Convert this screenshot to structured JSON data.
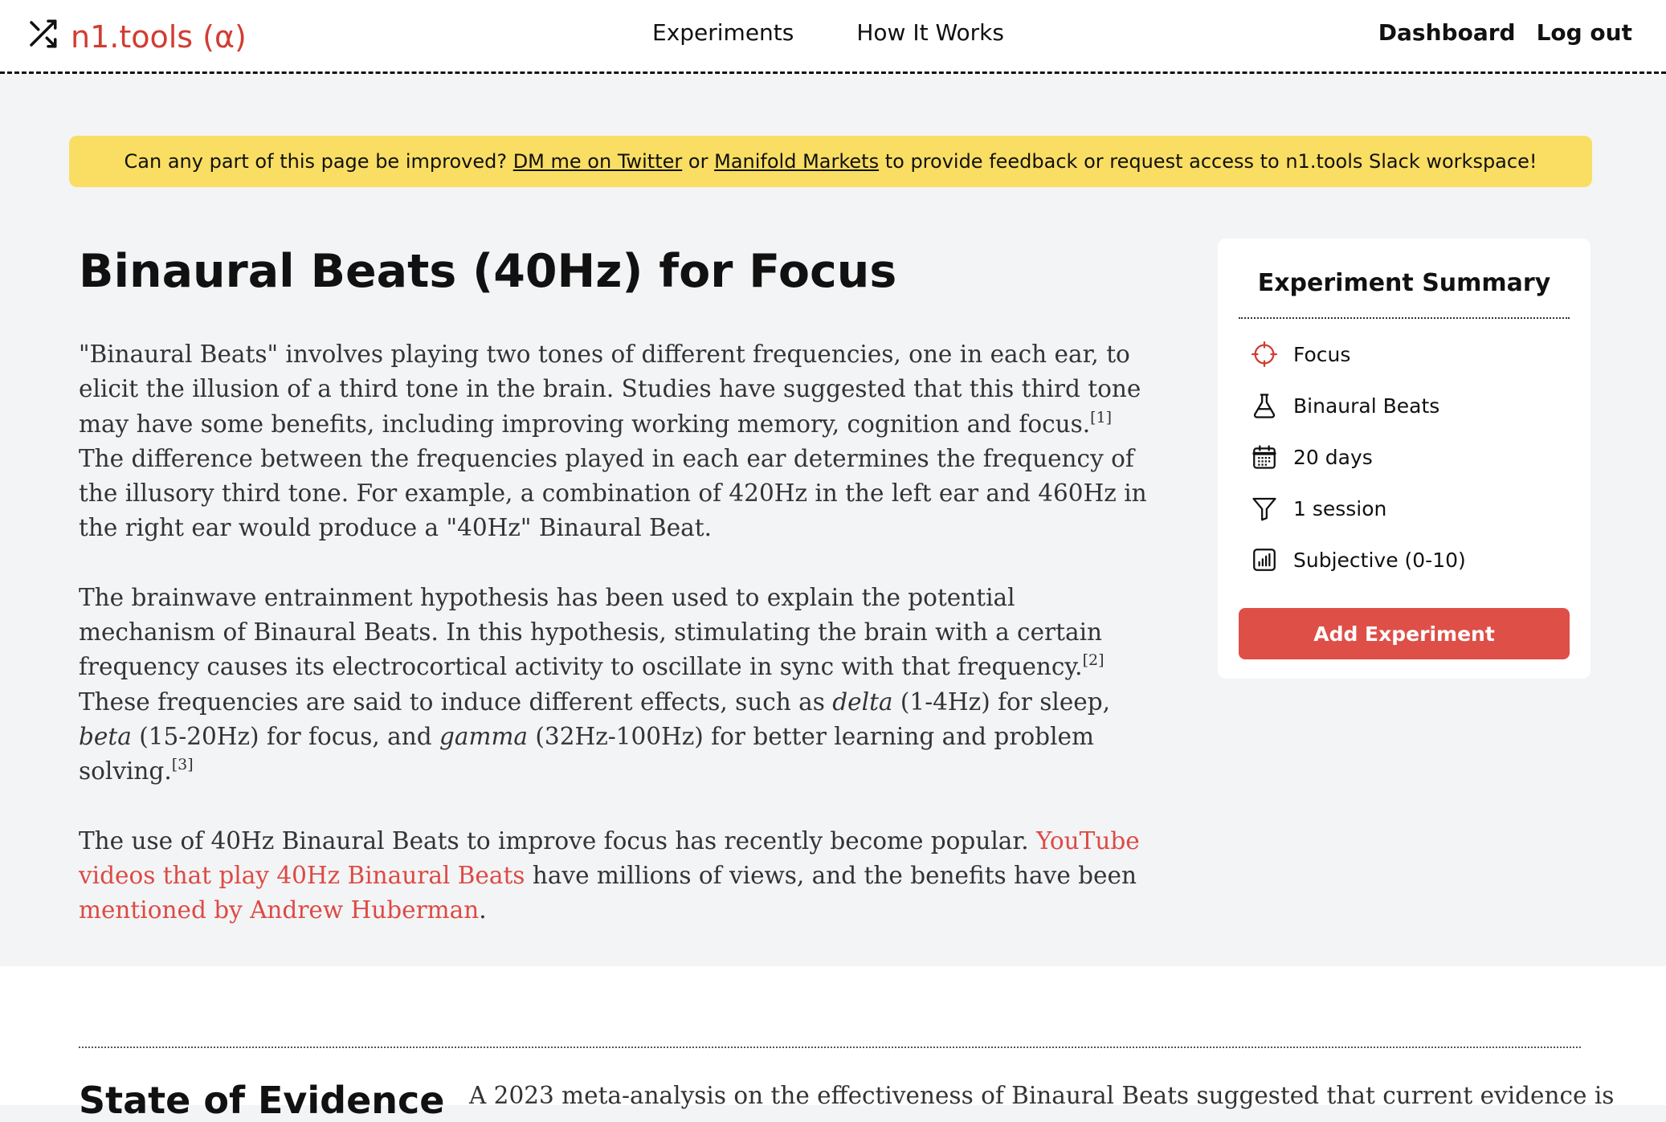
{
  "header": {
    "logo_text": "n1.tools (α)",
    "nav": [
      "Experiments",
      "How It Works"
    ],
    "right": [
      "Dashboard",
      "Log out"
    ]
  },
  "banner": {
    "prefix": "Can any part of this page be improved?",
    "link1": "DM me on Twitter",
    "middle": "or",
    "link2": "Manifold Markets",
    "suffix": "to provide feedback or request access to n1.tools Slack workspace!"
  },
  "article": {
    "title": "Binaural Beats (40Hz) for Focus",
    "p1": {
      "a": "\"Binaural Beats\" involves playing two tones of different frequencies, one in each ear, to elicit the illusion of a third tone in the brain. Studies have suggested that this third tone may have some benefits, including improving working memory, cognition and focus.",
      "ref1": "[1]",
      "b": "The difference between the frequencies played in each ear determines the frequency of the illusory third tone. For example, a combination of 420Hz in the left ear and 460Hz in the right ear would produce a \"40Hz\" Binaural Beat."
    },
    "p2": {
      "a": "The brainwave entrainment hypothesis has been used to explain the potential mechanism of Binaural Beats. In this hypothesis, stimulating the brain with a certain frequency causes its electrocortical activity to oscillate in sync with that frequency.",
      "ref2": "[2]",
      "b": "These frequencies are said to induce different effects, such as",
      "delta": "delta",
      "c": "(1-4Hz) for sleep,",
      "beta": "beta",
      "d": "(15-20Hz) for focus, and",
      "gamma": "gamma",
      "e": "(32Hz-100Hz) for better learning and problem solving.",
      "ref3": "[3]"
    },
    "p3": {
      "a": "The use of 40Hz Binaural Beats to improve focus has recently become popular.",
      "link1": "YouTube videos that play 40Hz Binaural Beats",
      "b": "have millions of views, and the benefits have been",
      "link2": "mentioned by Andrew Huberman",
      "c": "."
    }
  },
  "summary": {
    "title": "Experiment Summary",
    "rows": [
      {
        "icon": "crosshair-icon",
        "label": "Focus"
      },
      {
        "icon": "flask-icon",
        "label": "Binaural Beats"
      },
      {
        "icon": "calendar-icon",
        "label": "20 days"
      },
      {
        "icon": "funnel-icon",
        "label": "1 session"
      },
      {
        "icon": "bar-chart-icon",
        "label": "Subjective (0-10)"
      }
    ],
    "button": "Add Experiment"
  },
  "evidence": {
    "heading": "State of Evidence",
    "text": "A 2023 meta-analysis on the effectiveness of Binaural Beats suggested that current evidence is"
  },
  "colors": {
    "accent": "#d23c33",
    "banner": "#f9de63",
    "button": "#de4f48",
    "background": "#f3f4f6"
  }
}
